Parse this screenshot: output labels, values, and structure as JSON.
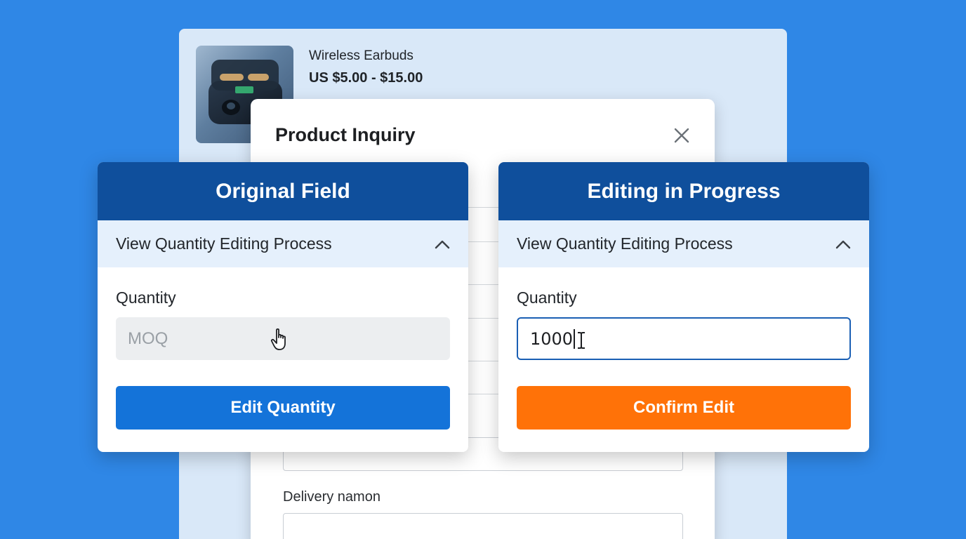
{
  "product": {
    "name": "Wireless Earbuds",
    "price": "US $5.00 - $15.00"
  },
  "modal": {
    "title": "Product Inquiry",
    "delivery_label": "Delivery namon"
  },
  "panels": {
    "original": {
      "header": "Original Field",
      "accordion_label": "View Quantity Editing Process",
      "field_label": "Quantity",
      "placeholder": "MOQ",
      "button_label": "Edit Quantity"
    },
    "editing": {
      "header": "Editing in Progress",
      "accordion_label": "View Quantity Editing Process",
      "field_label": "Quantity",
      "value": "1000",
      "button_label": "Confirm Edit"
    }
  },
  "colors": {
    "background": "#2f87e6",
    "header": "#0f4f9c",
    "primary_button": "#1473d9",
    "confirm_button": "#ff7208"
  }
}
